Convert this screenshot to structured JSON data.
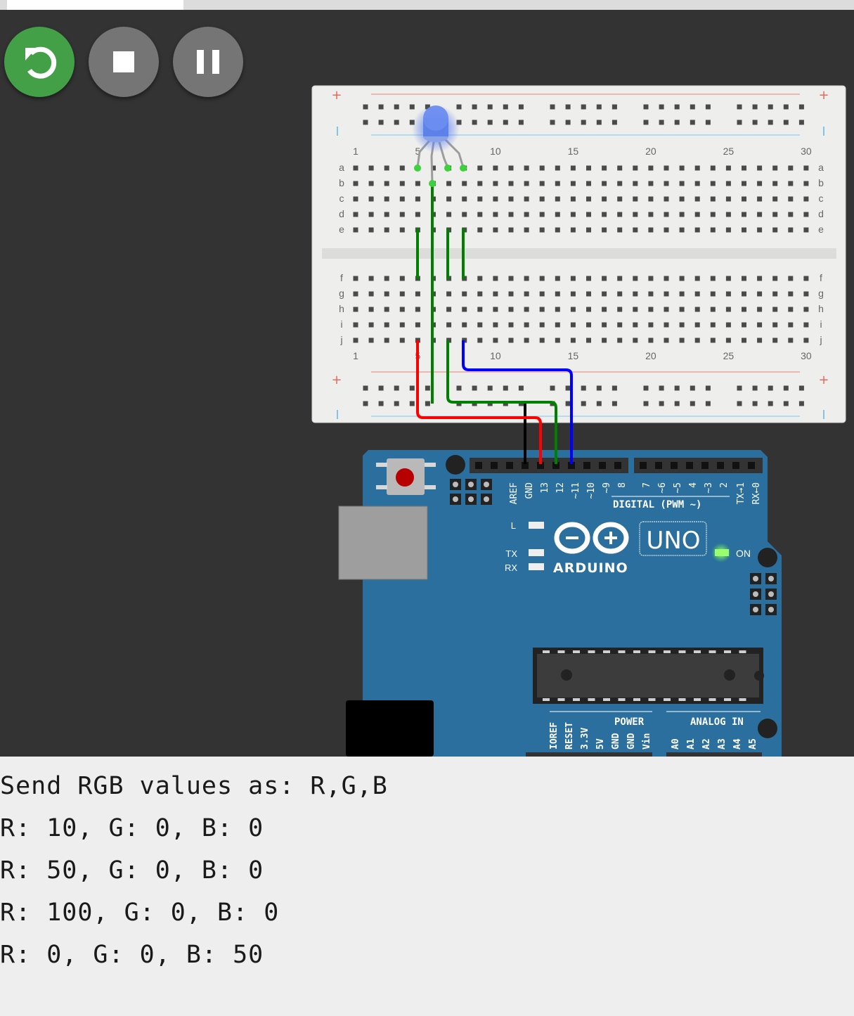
{
  "controls": {
    "restart": "restart-icon",
    "stop": "stop-icon",
    "pause": "pause-icon"
  },
  "breadboard": {
    "column_numbers": [
      "1",
      "5",
      "10",
      "15",
      "20",
      "25",
      "30"
    ],
    "rows_top": [
      "a",
      "b",
      "c",
      "d",
      "e"
    ],
    "rows_bottom": [
      "f",
      "g",
      "h",
      "i",
      "j"
    ],
    "rail_plus": "+"
  },
  "arduino": {
    "header_labels": [
      "AREF",
      "GND",
      "13",
      "12",
      "~11",
      "~10",
      "~9",
      "8",
      "7",
      "~6",
      "~5",
      "4",
      "~3",
      "2",
      "TX→1",
      "RX←0"
    ],
    "digital_label": "DIGITAL (PWM ~)",
    "led_l": "L",
    "led_tx": "TX",
    "led_rx": "RX",
    "logo": "ARDUINO",
    "model": "UNO",
    "on_label": "ON",
    "power_label": "POWER",
    "analog_label": "ANALOG IN",
    "power_pins": [
      "IOREF",
      "RESET",
      "3.3V",
      "5V",
      "GND",
      "GND",
      "Vin"
    ],
    "analog_pins": [
      "A0",
      "A1",
      "A2",
      "A3",
      "A4",
      "A5"
    ]
  },
  "wires": {
    "red": "#ff0000",
    "green": "#008000",
    "blue": "#0000ff",
    "black": "#000000"
  },
  "serial": {
    "lines": [
      "Send RGB values as: R,G,B",
      "R: 10, G: 0, B: 0",
      "R: 50, G: 0, B: 0",
      "R: 100, G: 0, B: 0",
      "R: 0, G: 0, B: 50"
    ]
  }
}
